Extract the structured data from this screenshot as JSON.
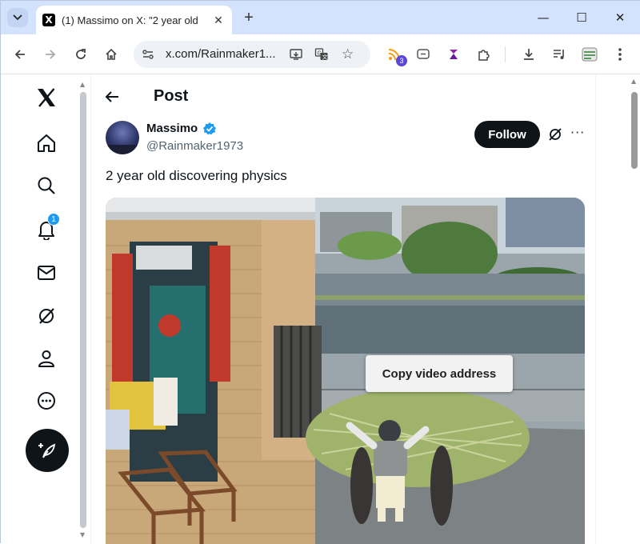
{
  "browser": {
    "tab_title": "(1) Massimo on X: \"2 year old",
    "favicon_glyph": "X",
    "url": "x.com/Rainmaker1...",
    "extension_badge": "3"
  },
  "nav": {
    "notification_count": "1"
  },
  "post": {
    "header_title": "Post",
    "author_name": "Massimo",
    "author_handle": "@Rainmaker1973",
    "follow_label": "Follow",
    "more_glyph": "···",
    "text": "2 year old discovering physics"
  },
  "context_menu": {
    "item_label": "Copy video address"
  },
  "colors": {
    "tab_strip": "#d3e3fd",
    "accent": "#1d9bf0",
    "follow_button": "#0f1419"
  }
}
